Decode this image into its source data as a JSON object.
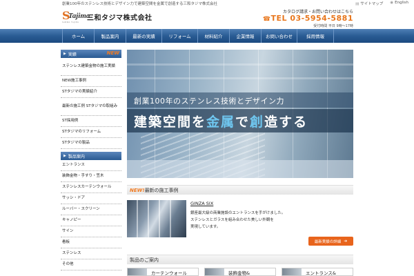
{
  "topbar": {
    "tagline": "創業100年のステンレス技術とデザイン力で建築空間を金属で創造する三和タジマ株式会社",
    "sitemap": "サイトマップ",
    "english": "English",
    "sitemap_icon": "document-icon",
    "english_icon": "globe-icon"
  },
  "header": {
    "logo_mark_s": "S",
    "logo_mark_t": "Tajima",
    "logo_mark_sub": "SANWA TAJIMA",
    "company": "三和タジマ株式会社",
    "contact_label": "カタログ請求・お問い合わせはこちら",
    "tel_icon": "☎",
    "tel": "TEL 03-5954-5881",
    "hours": "受付時間 平日 9時〜17時"
  },
  "nav": {
    "items": [
      "ホーム",
      "製品案内",
      "最新の実績",
      "リフォーム",
      "材料紹介",
      "企業情報",
      "お問い合わせ",
      "採用情報"
    ]
  },
  "sidebar": {
    "section1": {
      "title": "実績",
      "arrow": "▶",
      "badge": "NEW"
    },
    "items1": [
      "ステンレス建築金物の施工実績",
      "NEW施工事例",
      "STタジマの実績紹介",
      "最新の施工例 STタジマの取組み",
      "ST採用例",
      "STタジマのリフォーム",
      "STタジマの製品"
    ],
    "section2": {
      "title": "製品案内",
      "arrow": "▶"
    },
    "items2": [
      "エントランス",
      "装飾金物・手すり・笠木",
      "ステンレスカーテンウォール",
      "サッシ・ドア",
      "ルーバー・スクリーン",
      "キャノピー",
      "サイン",
      "看板",
      "ステンレス",
      "その他"
    ]
  },
  "hero": {
    "line1": "創業100年のステンレス技術とデザイン力",
    "line2_a": "建築空間を",
    "line2_b": "金属",
    "line2_c": "で",
    "line2_d": "創",
    "line2_e": "造する"
  },
  "news": {
    "badge": "NEW!",
    "title": "最新の施工事例",
    "item_title": "GINZA SIX",
    "item_body": [
      "銀座最大級の商業施設のエントランスを手がけました。",
      "ステンレスとガラスを組み合わせた美しい外観を",
      "実現しています。"
    ],
    "button": "最新実績の詳細",
    "button_arrow": "➔"
  },
  "products": {
    "title": "製品のご案内",
    "cards": [
      "カーテンウォール",
      "装飾金物&",
      "エントランス&"
    ]
  }
}
